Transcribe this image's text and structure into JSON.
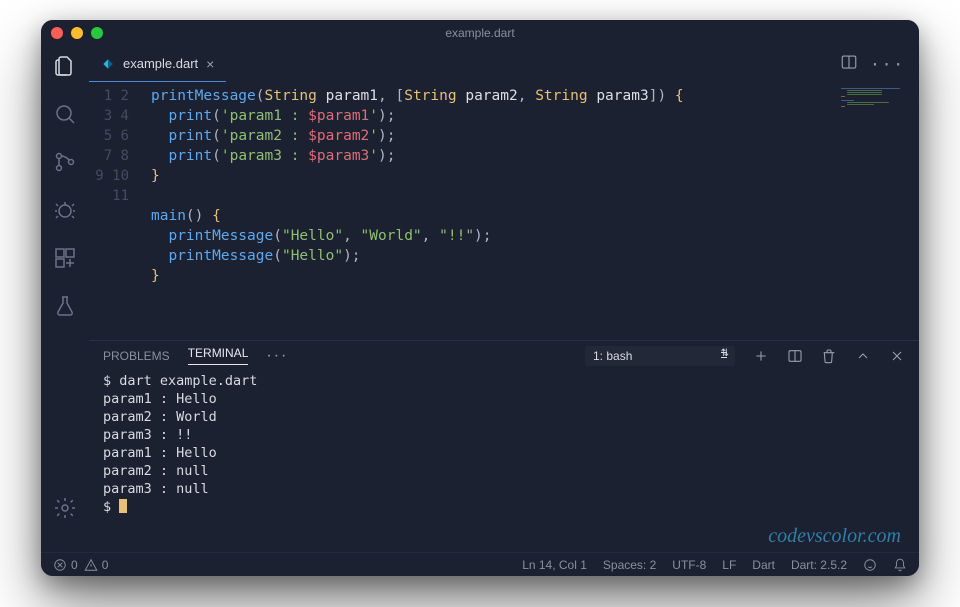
{
  "window": {
    "title": "example.dart"
  },
  "tab": {
    "filename": "example.dart"
  },
  "code": {
    "lines": [
      1,
      2,
      3,
      4,
      5,
      6,
      7,
      8,
      9,
      10,
      11
    ],
    "tokens": {
      "fn_printMessage": "printMessage",
      "ty_String": "String",
      "p1": "param1",
      "p2": "param2",
      "p3": "param3",
      "fn_print": "print",
      "s_p1a": "'param1 : ",
      "s_p2a": "'param2 : ",
      "s_p3a": "'param3 : ",
      "iv_p1": "$param1",
      "iv_p2": "$param2",
      "iv_p3": "$param3",
      "s_end": "'",
      "fn_main": "main",
      "s_hello": "\"Hello\"",
      "s_world": "\"World\"",
      "s_bang": "\"!!\""
    }
  },
  "panel": {
    "tabs": {
      "problems": "PROBLEMS",
      "terminal": "TERMINAL"
    },
    "shell_selector": "1: bash",
    "output": [
      "$ dart example.dart",
      "param1 : Hello",
      "param2 : World",
      "param3 : !!",
      "param1 : Hello",
      "param2 : null",
      "param3 : null",
      "$ "
    ]
  },
  "status": {
    "errors": "0",
    "warnings": "0",
    "cursor": "Ln 14, Col 1",
    "spaces": "Spaces: 2",
    "encoding": "UTF-8",
    "eol": "LF",
    "lang": "Dart",
    "sdk": "Dart: 2.5.2"
  },
  "watermark": "codevscolor.com"
}
